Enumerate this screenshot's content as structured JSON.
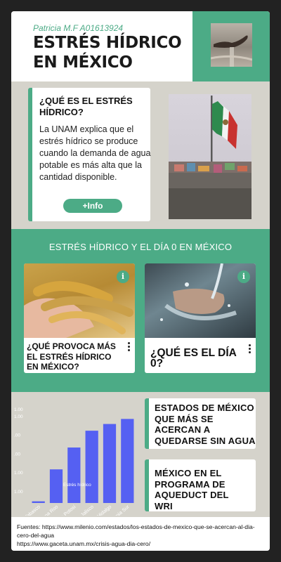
{
  "header": {
    "author": "Patricia M.F   A01613924",
    "title": "ESTRÉS HÍDRICO EN MÉXICO",
    "photo_icon": "hand-water-photo"
  },
  "question_card": {
    "title": "¿QUÉ ES EL ESTRÉS HÍDRICO?",
    "body": "La UNAM explica que el estrés hídrico se produce cuando la demanda de agua potable es más alta que la cantidad disponible.",
    "button_label": "+Info"
  },
  "flag_photo_icon": "mexico-flag-zocalo-photo",
  "band": {
    "title": "ESTRÉS HÍDRICO Y EL DÍA 0 EN MÉXICO",
    "cards": [
      {
        "caption": "¿QUÉ PROVOCA MÁS EL ESTRÉS HÍDRICO EN MÉXICO?",
        "info_glyph": "i",
        "photo_icon": "wheat-photo"
      },
      {
        "caption": "¿QUÉ ES EL DÍA 0?",
        "info_glyph": "i",
        "photo_icon": "water-hands-photo"
      }
    ]
  },
  "chart_data": {
    "type": "bar",
    "categories": [
      "Tabasco",
      "Quintana Roo",
      "San Luis Potosí",
      "Jalisco",
      "Hidalgo",
      "California Sur"
    ],
    "series": [
      {
        "name": "Estrés hídrico",
        "values": [
          0.1,
          2.0,
          3.3,
          4.3,
          4.7,
          5.0
        ]
      }
    ],
    "ytick_labels": [
      "1.00",
      "1.00",
      ".00",
      ".00",
      "1.00",
      "1.00"
    ],
    "ylim": [
      0,
      5.6
    ],
    "grid": false,
    "legend": "top",
    "color": "#5560f2"
  },
  "right_boxes": [
    {
      "text": "ESTADOS DE MÉXICO QUE MÁS SE ACERCAN A QUEDARSE SIN AGUA"
    },
    {
      "text": "MÉXICO EN EL PROGRAMA DE AQUEDUCT DEL WRI"
    }
  ],
  "footer": {
    "line1": "Fuentes: https://www.milenio.com/estados/los-estados-de-mexico-que-se-acercan-al-dia-cero-del-agua",
    "line2": "https://www.gaceta.unam.mx/crisis-agua-dia-cero/"
  },
  "colors": {
    "accent": "#4cab86",
    "background": "#d5d3cb",
    "bar": "#5560f2"
  }
}
